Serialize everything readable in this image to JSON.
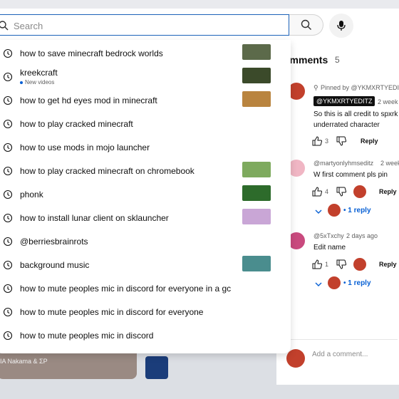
{
  "search": {
    "placeholder": "Search",
    "value": ""
  },
  "suggestions": [
    {
      "text": "how to save minecraft bedrock worlds",
      "thumb": "#5c6a4a"
    },
    {
      "text": "kreekcraft",
      "sub": "New videos",
      "thumb": "#3b4a2a"
    },
    {
      "text": "how to get hd eyes mod in minecraft",
      "thumb": "#b9843f"
    },
    {
      "text": "how to play cracked minecraft"
    },
    {
      "text": "how to use mods in mojo launcher"
    },
    {
      "text": "how to play cracked minecraft on chromebook",
      "thumb": "#7eaa5e"
    },
    {
      "text": "phonk",
      "thumb": "#2d6b2b"
    },
    {
      "text": "how to install lunar client on sklauncher",
      "thumb": "#c9a6d6"
    },
    {
      "text": "@berriesbrainrots"
    },
    {
      "text": "background music",
      "thumb": "#4a8d8e"
    },
    {
      "text": "how to mute peoples mic in discord for everyone in a gc"
    },
    {
      "text": "how to mute peoples mic in discord for everyone"
    },
    {
      "text": "how to mute peoples mic in discord"
    }
  ],
  "background_video": {
    "title": "IA   Nakama & ΣP"
  },
  "comments": {
    "title": "omments",
    "count": "5",
    "items": [
      {
        "pinned_label": "Pinned by @YKMXRTYEDITZ",
        "handle": "@YKMXRTYEDITZ",
        "time": "2 week",
        "lines": [
          "So this is all credit to spxrk",
          "underrated character"
        ],
        "likes": "3",
        "reply_label": "Reply",
        "avatar_color": "#c2402c"
      },
      {
        "handle": "@martyonlyhmseditz",
        "time": "2 week",
        "lines": [
          "W first comment pls pin"
        ],
        "likes": "4",
        "reply_label": "Reply",
        "replies_label": "1 reply",
        "avatar_color": "#f0b6c4"
      },
      {
        "handle": "@5xTxchy",
        "time": "2 days ago",
        "lines": [
          "Edit name"
        ],
        "likes": "1",
        "reply_label": "Reply",
        "replies_label": "1 reply",
        "avatar_color": "#c94a7e"
      }
    ],
    "add_comment_placeholder": "Add a comment..."
  },
  "colors": {
    "link_blue": "#065fd4",
    "focus_border": "#1c62b9"
  }
}
